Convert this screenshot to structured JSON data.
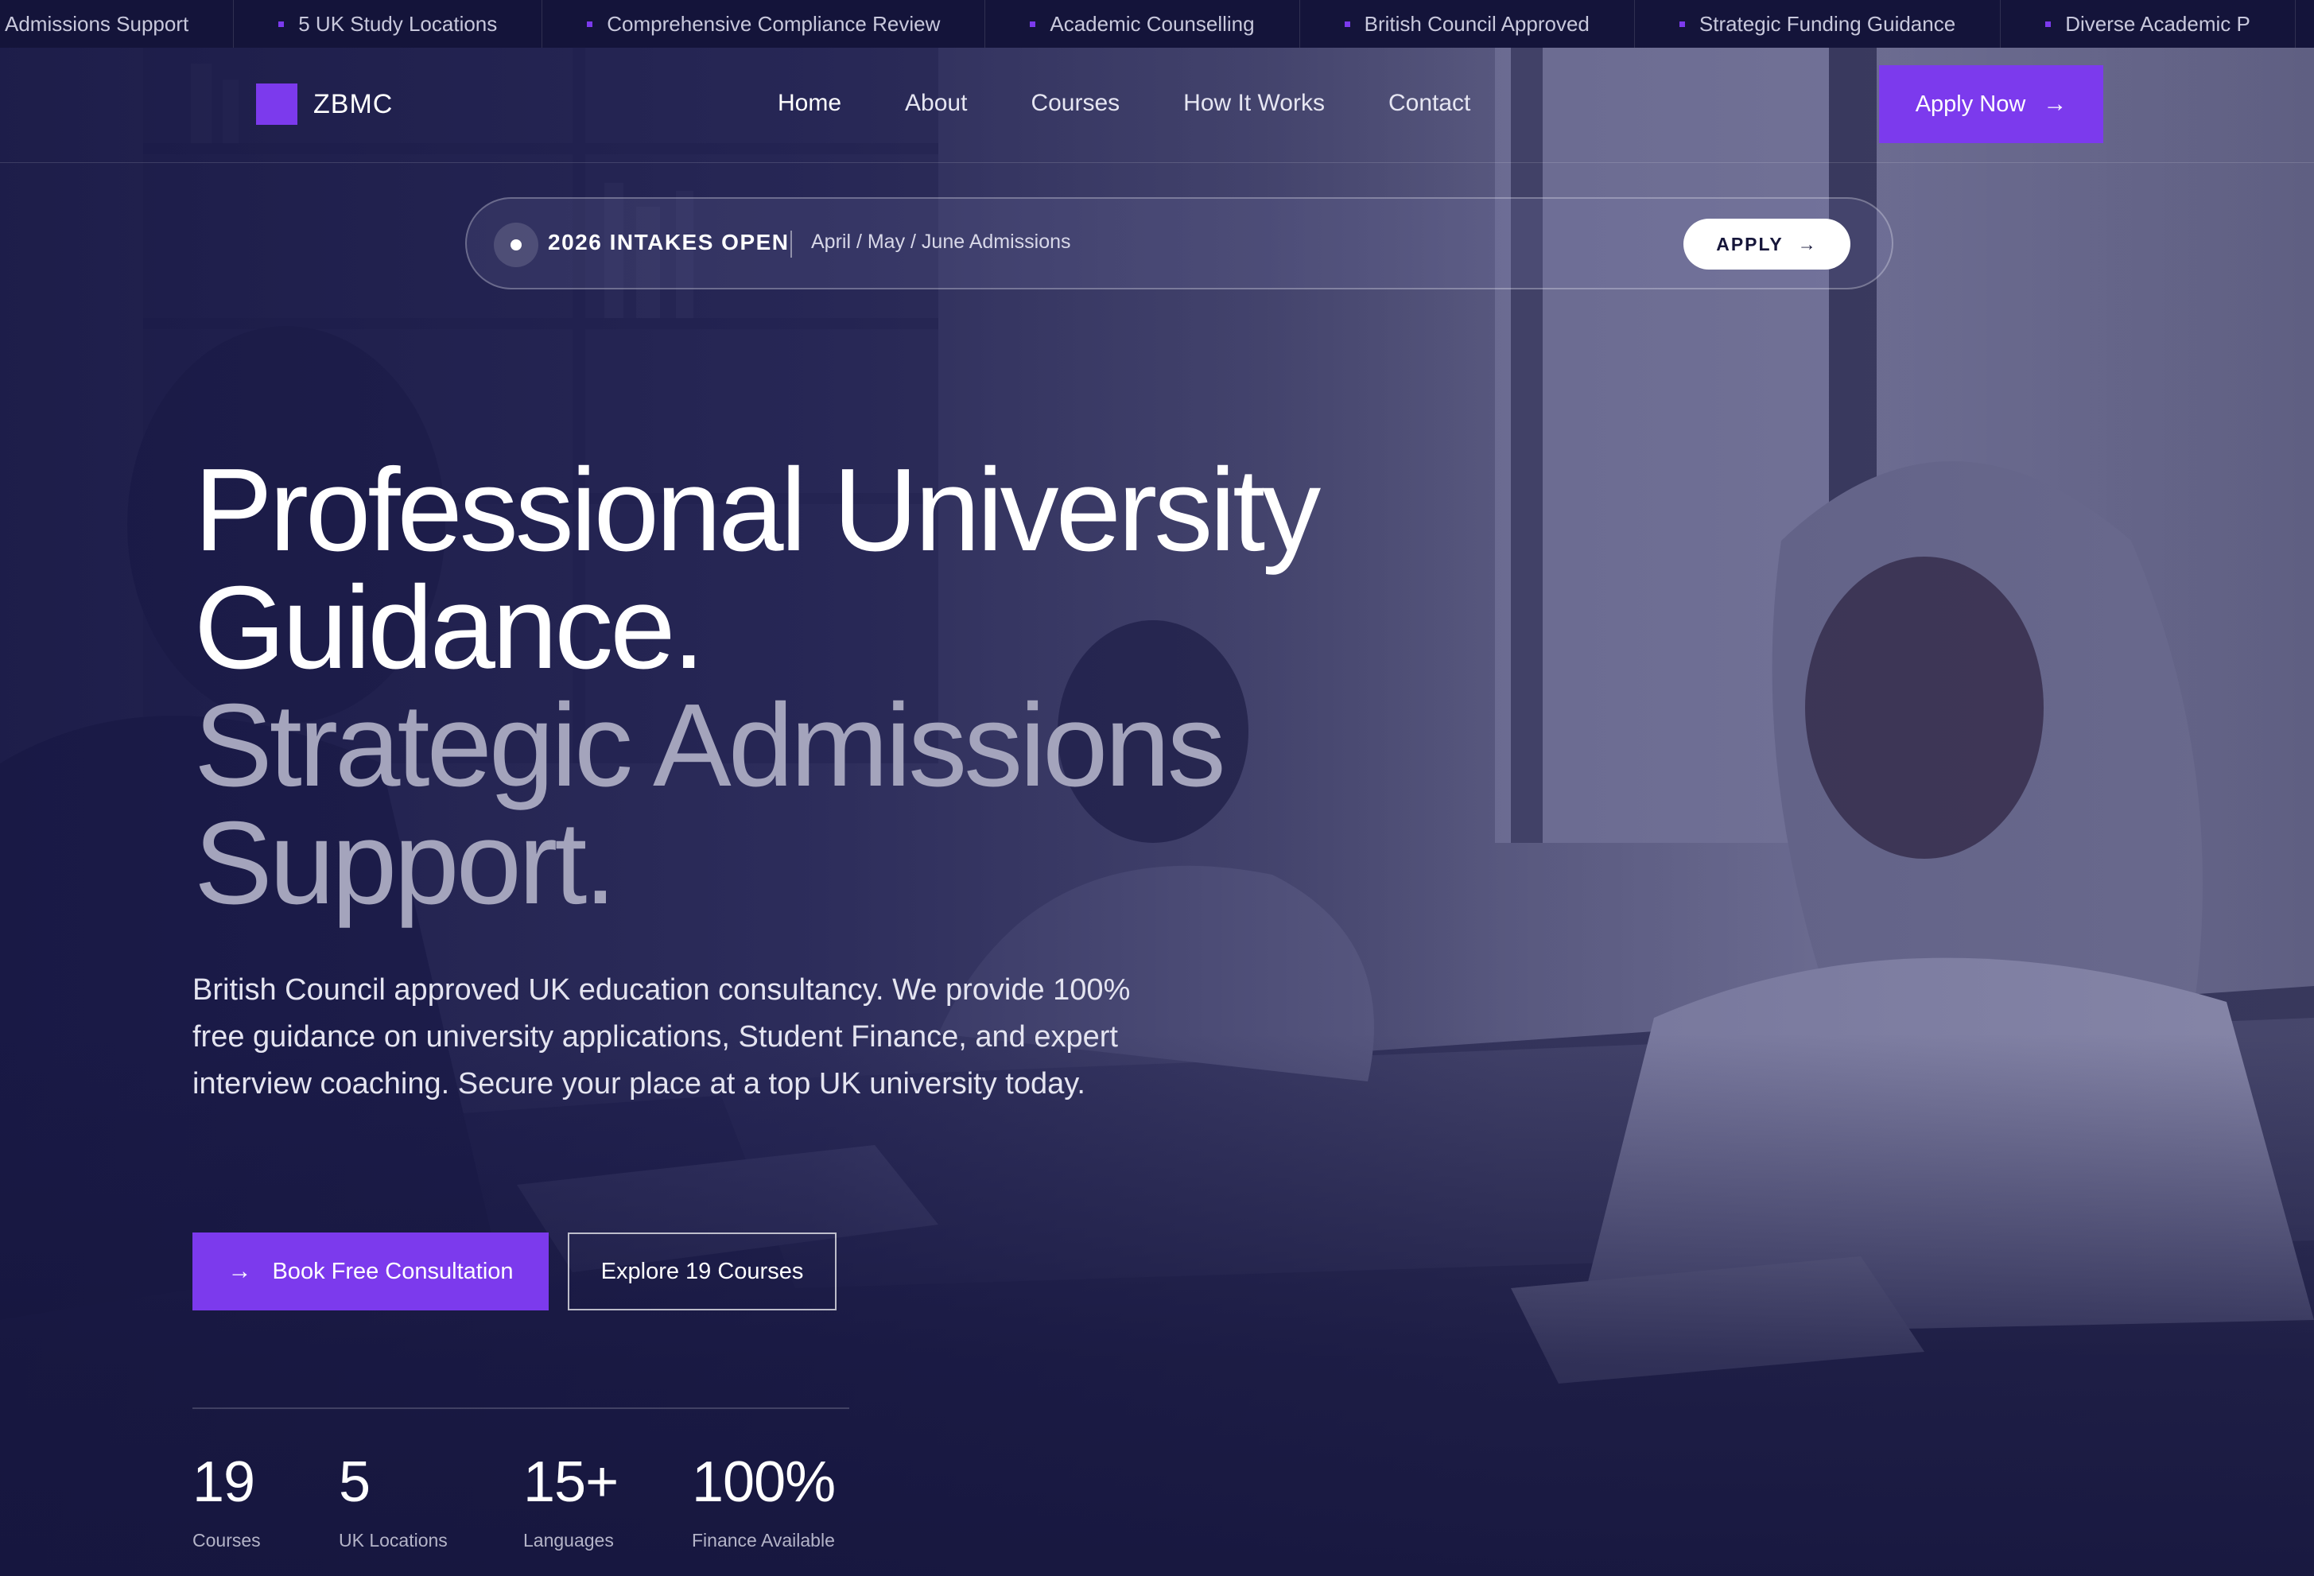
{
  "ticker": [
    "Admissions Support",
    "5 UK Study Locations",
    "Comprehensive Compliance Review",
    "Academic Counselling",
    "British Council Approved",
    "Strategic Funding Guidance",
    "Diverse Academic P"
  ],
  "brand": {
    "name": "ZBMC",
    "accent": "#7c3aed"
  },
  "nav": {
    "links": [
      "Home",
      "About",
      "Courses",
      "How It Works",
      "Contact"
    ],
    "cta": "Apply Now"
  },
  "intake": {
    "title": "2026 INTAKES OPEN",
    "subtitle": "April / May / June Admissions",
    "cta": "APPLY"
  },
  "hero": {
    "line1": "Professional University",
    "line2": "Guidance.",
    "line3": "Strategic Admissions",
    "line4": "Support.",
    "description": "British Council approved UK education consultancy. We provide 100% free guidance on university applications, Student Finance, and expert interview coaching. Secure your place at a top UK university today.",
    "primary_cta": "Book Free Consultation",
    "secondary_cta": "Explore 19 Courses"
  },
  "stats": [
    {
      "value": "19",
      "label": "Courses"
    },
    {
      "value": "5",
      "label": "UK Locations"
    },
    {
      "value": "15+",
      "label": "Languages"
    },
    {
      "value": "100%",
      "label": "Finance Available"
    }
  ]
}
